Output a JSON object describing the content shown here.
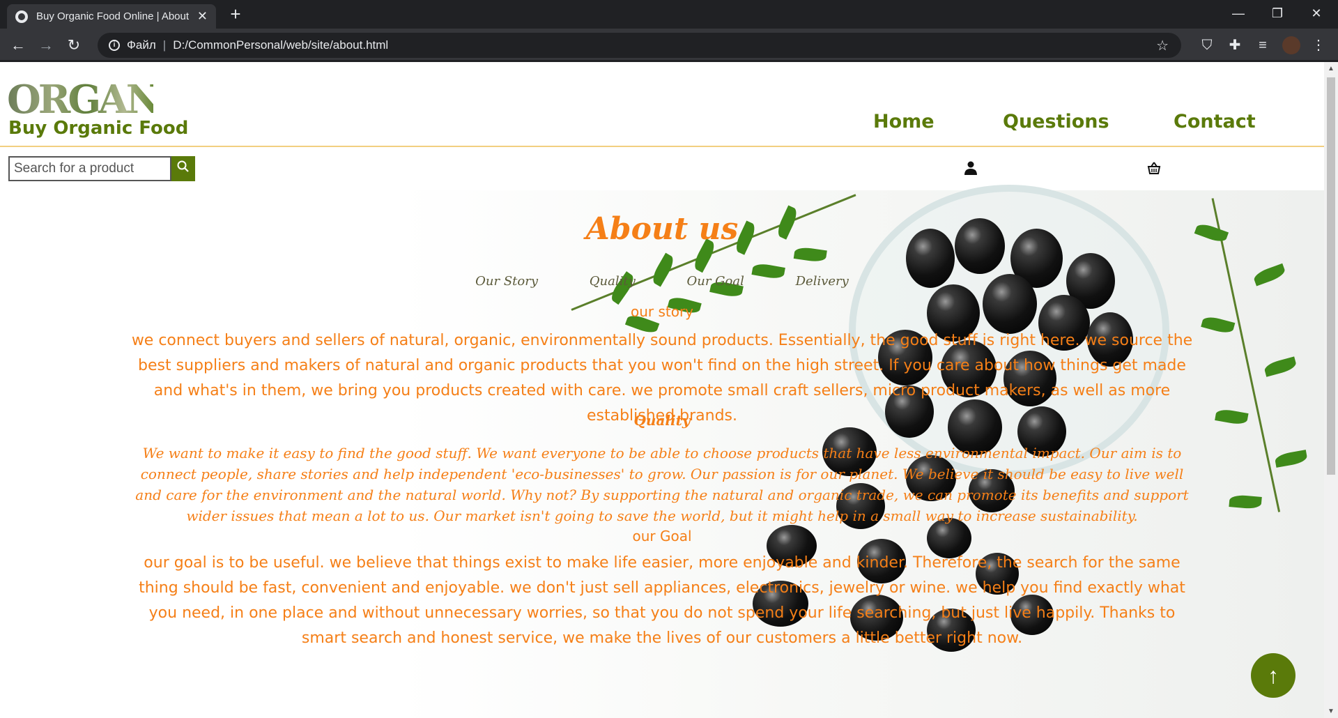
{
  "browser": {
    "tab_title": "Buy Organic Food Online | About",
    "address_label": "Файл",
    "address_url": "D:/CommonPersonal/web/site/about.html"
  },
  "site": {
    "logo_art": "ORGANIC",
    "logo_text": "Buy Organic Food",
    "nav": [
      "Home",
      "Questions",
      "Contact"
    ],
    "search_placeholder": "Search for a product"
  },
  "about": {
    "title": "About us",
    "links": [
      "Our Story",
      "Quality",
      "Our Goal",
      "Delivery"
    ],
    "sections": [
      {
        "heading": "our story",
        "text": "we connect buyers and sellers of natural, organic, environmentally sound products. Essentially, the good stuff is right here. we source the best suppliers and makers of natural and organic products that you won't find on the high street. If you care about how things get made and what's in them, we bring you products created with care. we promote small craft sellers, micro product makers, as well as more established brands."
      },
      {
        "heading": "Quality",
        "text": "We want to make it easy to find the good stuff. We want everyone to be able to choose products that have less environmental impact. Our aim is to connect people, share stories and help independent 'eco-businesses' to grow. Our passion is for our planet. We believe it should be easy to live well and care for the environment and the natural world. Why not? By supporting the natural and organic trade, we can promote its benefits and support wider issues that mean a lot to us. Our market isn't going to save the world, but it might help in a small way to increase sustainability."
      },
      {
        "heading": "our Goal",
        "text": "our goal is to be useful. we believe that things exist to make life easier, more enjoyable and kinder. Therefore, the search for the same thing should be fast, convenient and enjoyable. we don't just sell appliances, electronics, jewelry or wine. we help you find exactly what you need, in one place and without unnecessary worries, so that you do not spend your life searching, but just live happily. Thanks to smart search and honest service, we make the lives of our customers a little better right now."
      }
    ],
    "to_top": "↑"
  },
  "colors": {
    "brand_green": "#5a7a0a",
    "accent_orange": "#f57f17",
    "header_line": "#f2cf80"
  }
}
